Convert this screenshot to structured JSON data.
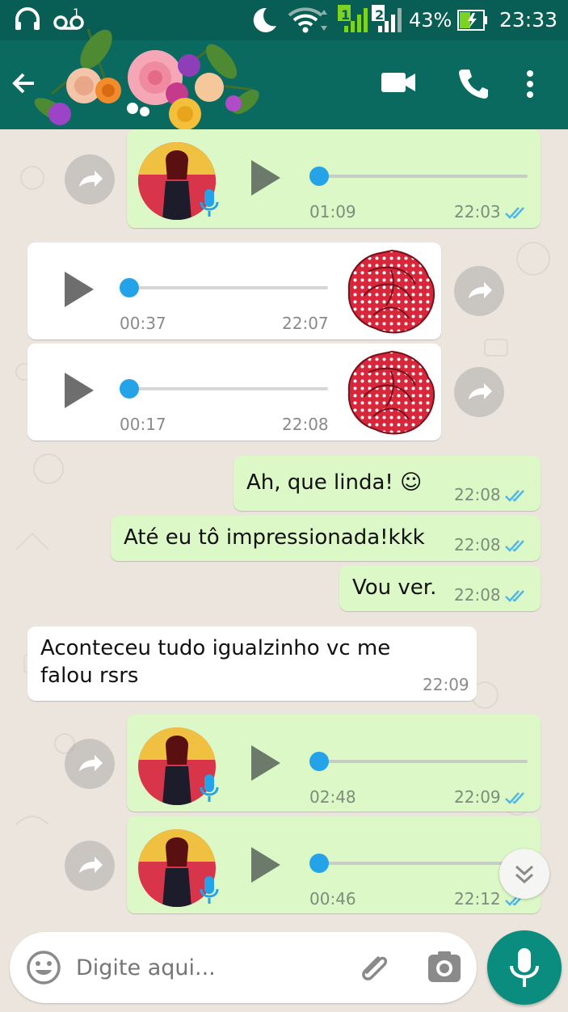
{
  "status_bar": {
    "battery_percent": "43%",
    "clock": "23:33",
    "sim1_label": "1",
    "sim2_label": "2",
    "voicemail_badge": "1"
  },
  "app_bar": {
    "icons": [
      "back-arrow-icon",
      "floral-avatar",
      "video-call-icon",
      "phone-call-icon",
      "more-vert-icon"
    ]
  },
  "messages": [
    {
      "type": "voice",
      "direction": "out",
      "duration": "01:09",
      "time": "22:03",
      "status": "read"
    },
    {
      "type": "voice",
      "direction": "in",
      "duration": "00:37",
      "time": "22:07"
    },
    {
      "type": "voice",
      "direction": "in",
      "duration": "00:17",
      "time": "22:08"
    },
    {
      "type": "text",
      "direction": "out",
      "text": "Ah, que linda! ☺",
      "time": "22:08",
      "status": "read"
    },
    {
      "type": "text",
      "direction": "out",
      "text": "Até eu tô impressionada!kkk",
      "time": "22:08",
      "status": "read"
    },
    {
      "type": "text",
      "direction": "out",
      "text": "Vou ver.",
      "time": "22:08",
      "status": "read"
    },
    {
      "type": "text",
      "direction": "in",
      "text_line1": "Aconteceu tudo igualzinho vc me",
      "text_line2": "falou rsrs",
      "time": "22:09"
    },
    {
      "type": "voice",
      "direction": "out",
      "duration": "02:48",
      "time": "22:09",
      "status": "read"
    },
    {
      "type": "voice",
      "direction": "out",
      "duration": "00:46",
      "time": "22:12",
      "status": "read"
    }
  ],
  "composer": {
    "placeholder": "Digite aqui...",
    "icons": [
      "emoji-icon",
      "attach-icon",
      "camera-icon",
      "mic-icon"
    ]
  },
  "colors": {
    "header": "#0a6a5f",
    "status_bar": "#085e54",
    "outgoing_bubble": "#dcf8c6",
    "incoming_bubble": "#ffffff",
    "read_ticks": "#4fb6ec",
    "voice_knob": "#25a3e8",
    "mic_button": "#0a8d7e"
  }
}
